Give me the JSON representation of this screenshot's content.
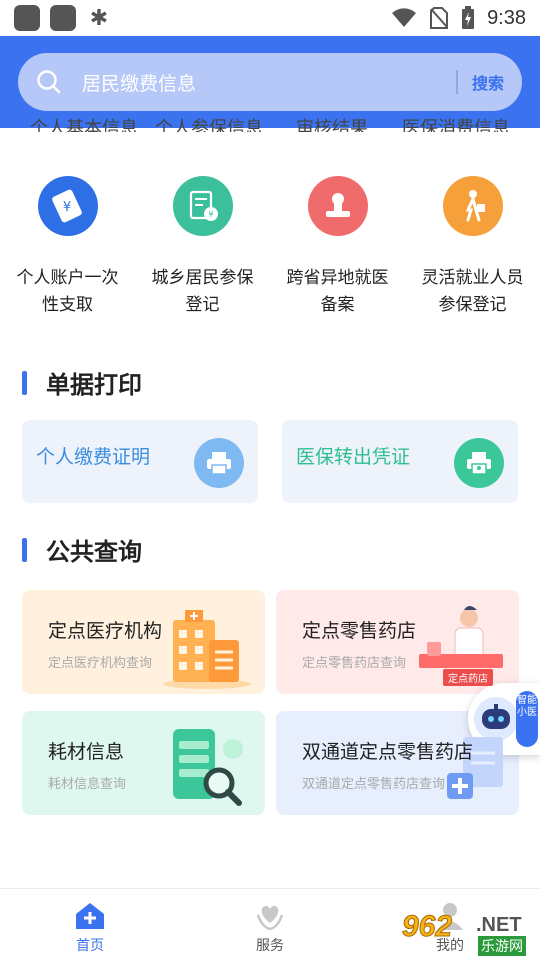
{
  "status_bar": {
    "time": "9:38"
  },
  "search": {
    "placeholder": "居民缴费信息",
    "button": "搜索"
  },
  "clipped_row": [
    "个人基本信息",
    "个人参保信息",
    "审核结果",
    "医保消费信息"
  ],
  "services": [
    {
      "label": "个人账户一次\n性支取",
      "icon": "account-withdraw-icon",
      "color": "#2f6fe6"
    },
    {
      "label": "城乡居民参保\n登记",
      "icon": "resident-enroll-icon",
      "color": "#3cbf9b"
    },
    {
      "label": "跨省异地就医\n备案",
      "icon": "stamp-icon",
      "color": "#f06c6c"
    },
    {
      "label": "灵活就业人员\n参保登记",
      "icon": "flexible-worker-icon",
      "color": "#f5a03a"
    }
  ],
  "sections": {
    "print": "单据打印",
    "query": "公共查询"
  },
  "print_cards": [
    {
      "label": "个人缴费证明",
      "color": "#3b8de0",
      "icon": "printer-icon",
      "icon_bg": "#7fb9f2"
    },
    {
      "label": "医保转出凭证",
      "color": "#2ebf8f",
      "icon": "certificate-icon",
      "icon_bg": "#3cc79a"
    }
  ],
  "query_cards": [
    {
      "title": "定点医疗机构",
      "subtitle": "定点医疗机构查询",
      "bg": "#fff1de"
    },
    {
      "title": "定点零售药店",
      "subtitle": "定点零售药店查询",
      "bg": "#ffe9e9",
      "sign": "定点药店"
    },
    {
      "title": "耗材信息",
      "subtitle": "耗材信息查询",
      "bg": "#dff8ef"
    },
    {
      "title": "双通道定点零售药店",
      "subtitle": "双通道定点零售药店查询",
      "bg": "#e7eefd"
    }
  ],
  "assistant": {
    "label": "智能小医"
  },
  "tabs": [
    {
      "label": "首页",
      "active": true
    },
    {
      "label": "服务",
      "active": false
    },
    {
      "label": "我的",
      "active": false
    }
  ],
  "watermark": {
    "number": "962",
    "net": ".NET",
    "cn": "乐游网"
  }
}
